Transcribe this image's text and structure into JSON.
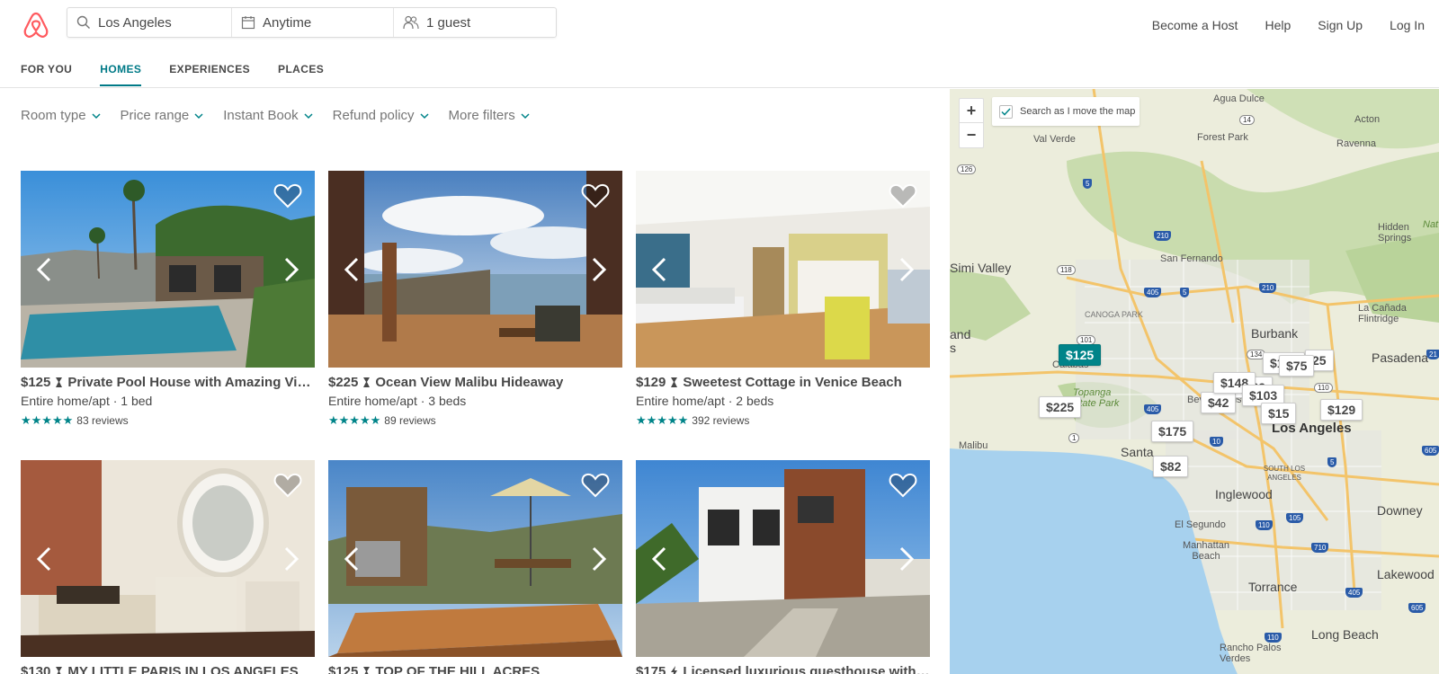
{
  "header": {
    "search": {
      "location": "Los Angeles",
      "dates": "Anytime",
      "guests": "1 guest"
    },
    "nav": {
      "become_host": "Become a Host",
      "help": "Help",
      "sign_up": "Sign Up",
      "log_in": "Log In"
    },
    "tabs": [
      "FOR YOU",
      "HOMES",
      "EXPERIENCES",
      "PLACES"
    ],
    "active_tab": "HOMES"
  },
  "filters": [
    "Room type",
    "Price range",
    "Instant Book",
    "Refund policy",
    "More filters"
  ],
  "listings": [
    {
      "price": "$125",
      "badge": "superhost-icon",
      "title": "Private Pool House with Amazing Vie...",
      "type": "Entire home/apt · 1 bed",
      "reviews": "83 reviews"
    },
    {
      "price": "$225",
      "badge": "superhost-icon",
      "title": "Ocean View Malibu Hideaway",
      "type": "Entire home/apt · 3 beds",
      "reviews": "89 reviews"
    },
    {
      "price": "$129",
      "badge": "superhost-icon",
      "title": "Sweetest Cottage in Venice Beach",
      "type": "Entire home/apt · 2 beds",
      "reviews": "392 reviews"
    },
    {
      "price": "$130",
      "badge": "superhost-icon",
      "title": "MY LITTLE PARIS IN LOS ANGELES",
      "type": "",
      "reviews": ""
    },
    {
      "price": "$125",
      "badge": "superhost-icon",
      "title": "TOP OF THE HILL ACRES",
      "type": "",
      "reviews": ""
    },
    {
      "price": "$175",
      "badge": "instant-book-icon",
      "title": "Licensed luxurious guesthouse with Pa...",
      "type": "",
      "reviews": ""
    }
  ],
  "map": {
    "search_as_move": "Search as I move the map",
    "zoom_in": "+",
    "zoom_out": "−",
    "pins": [
      "$125",
      "$225",
      "$175",
      "$82",
      "$42",
      "$148",
      "$103",
      "$15",
      "$75",
      "$129",
      "$129",
      "25",
      "$129"
    ],
    "places": {
      "agua_dulce": "Agua Dulce",
      "acton": "Acton",
      "val_verde": "Val Verde",
      "forest_park": "Forest Park",
      "ravenna": "Ravenna",
      "hidden_springs": "Hidden Springs",
      "simi_valley": "Simi Valley",
      "san_fernando": "San Fernando",
      "canoga_park": "CANOGA PARK",
      "burbank": "Burbank",
      "la_canada": "La Cañada Flintridge",
      "calabasas": "Calabas",
      "pasadena": "Pasadena",
      "topanga": "Topanga State Park",
      "beverly": "Beverly Hills",
      "los_angeles": "Los Angeles",
      "malibu": "Malibu",
      "santa_monica": "Santa",
      "south_la": "SOUTH LOS ANGELES",
      "inglewood": "Inglewood",
      "downey": "Downey",
      "el_segundo": "El Segundo",
      "manhattan_beach": "Manhattan Beach",
      "lakewood": "Lakewood",
      "torrance": "Torrance",
      "long_beach": "Long Beach",
      "rancho": "Rancho Palos Verdes",
      "nat": "Nat",
      "and": "and",
      "s": "s"
    }
  },
  "colors": {
    "brand": "#FF5A5F",
    "accent": "#008489",
    "active_tab": "#007A87",
    "text": "#484848"
  }
}
